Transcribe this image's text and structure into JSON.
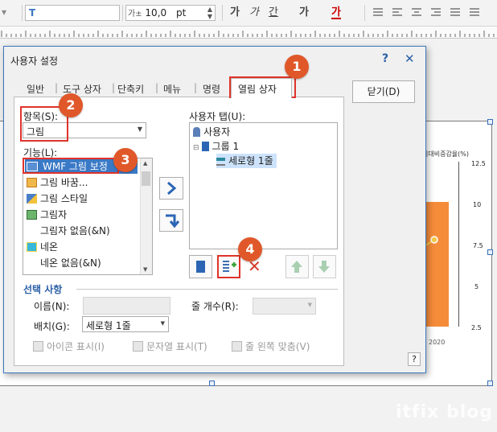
{
  "toolbar": {
    "style_glyph": "T",
    "font_size_icon": "가±",
    "font_size_value": "10,0",
    "font_size_unit": "pt",
    "format_buttons": [
      "가",
      "가",
      "간",
      "가",
      "가"
    ]
  },
  "dialog": {
    "title": "사용자 설정",
    "help_glyph": "?",
    "close_glyph": "✕",
    "tabs": [
      "일반",
      "도구 상자",
      "단축키",
      "메뉴",
      "명령",
      "열림 상자"
    ],
    "close_button": "닫기(D)",
    "item_label": "항목(S):",
    "item_value": "그림",
    "function_label": "기능(L):",
    "function_items": [
      "WMF 그림 보정",
      "그림 바꿈...",
      "그림 스타일",
      "그림자",
      "그림자 없음(&N)",
      "네온",
      "네온 없음(&N)"
    ],
    "user_tab_label": "사용자 탭(U):",
    "tree": {
      "root": "사용자",
      "group": "그룹 1",
      "child": "세로형 1줄"
    },
    "selection_group": "선택 사항",
    "name_label": "이름(N):",
    "name_value": "",
    "rows_label": "줄 개수(R):",
    "layout_label": "배치(G):",
    "layout_value": "세로형 1줄",
    "checkbox_icon": "아이콘 표시(I)",
    "checkbox_text": "문자열 표시(T)",
    "checkbox_left": "줄 왼쪽 맞춤(V)",
    "help_button": "?"
  },
  "callouts": [
    "1",
    "2",
    "3",
    "4"
  ],
  "chart": {
    "label_top": "기대비증감율(%)",
    "ticks": [
      "12.5",
      "10",
      "7.5",
      "5",
      "2.5"
    ],
    "year": "2020"
  },
  "watermark": "itfix blog",
  "colors": {
    "accent": "#3b77c0",
    "callout": "#e0582a",
    "highlight": "#e0332a",
    "chart_bar": "#f58c3a"
  }
}
